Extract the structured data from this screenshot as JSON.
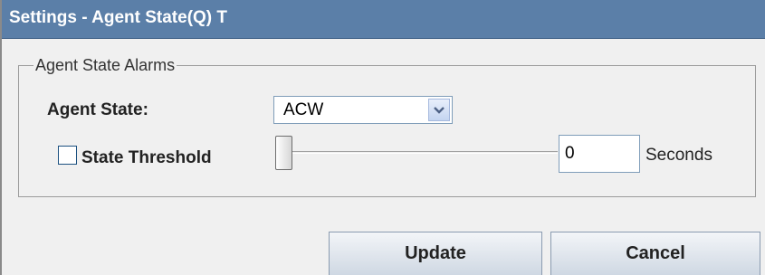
{
  "window": {
    "title": "Settings - Agent State(Q) T"
  },
  "group": {
    "legend": "Agent State Alarms",
    "agent_state_label": "Agent State:",
    "agent_state_value": "ACW",
    "threshold": {
      "label": "State Threshold",
      "checked": false,
      "slider_level": 0,
      "value": "0",
      "units": "Seconds"
    }
  },
  "buttons": {
    "update": "Update",
    "cancel": "Cancel"
  },
  "icons": {
    "dropdown": "chevron-down-icon",
    "checkbox": "checkbox-unchecked-icon"
  },
  "colors": {
    "titlebar": "#5b7fa8",
    "title_text": "#ffffff",
    "panel": "#f0f0f0"
  }
}
